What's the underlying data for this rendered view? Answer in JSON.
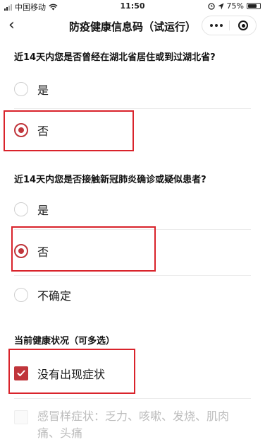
{
  "status_bar": {
    "carrier": "中国移动",
    "time": "11:50",
    "battery": "75%",
    "battery_level": 0.75
  },
  "nav": {
    "back_icon": "‹",
    "title": "防疫健康信息码（试运行）"
  },
  "question1": {
    "title": "近14天内您是否曾经在湖北省居住或到过湖北省?",
    "options": [
      {
        "label": "是",
        "selected": false
      },
      {
        "label": "否",
        "selected": true
      }
    ]
  },
  "question2": {
    "title": "近14天内您是否接触新冠肺炎确诊或疑似患者?",
    "options": [
      {
        "label": "是",
        "selected": false
      },
      {
        "label": "否",
        "selected": true
      },
      {
        "label": "不确定",
        "selected": false
      }
    ]
  },
  "question3": {
    "title": "当前健康状况（可多选）",
    "options": [
      {
        "label": "没有出现症状",
        "checked": true
      },
      {
        "label": "感冒样症状：乏力、咳嗽、发烧、肌肉痛、头痛",
        "checked": false,
        "disabled": true
      }
    ]
  },
  "colors": {
    "accent": "#c0353b",
    "highlight": "#d9232b"
  }
}
